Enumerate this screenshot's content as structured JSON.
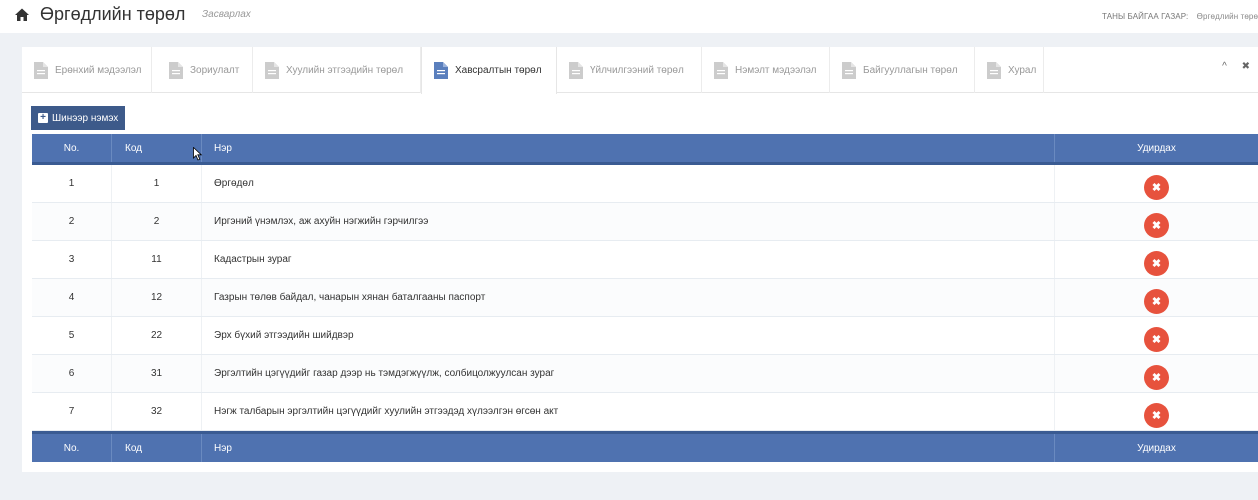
{
  "header": {
    "title": "Өргөдлийн төрөл",
    "subtitle": "Засварлах",
    "home_icon": "home-icon",
    "breadcrumb": [
      "ТАНЫ БАЙГАА ГАЗАР:",
      "Өргөдлийн төрө"
    ]
  },
  "tabs": [
    {
      "label": "Ерөнхий мэдээлэл",
      "active": false
    },
    {
      "label": "Зориулалт",
      "active": false
    },
    {
      "label": "Хуулийн этгээдийн төрөл",
      "active": false
    },
    {
      "label": "Хавсралтын төрөл",
      "active": true
    },
    {
      "label": "Үйлчилгээний төрөл",
      "active": false
    },
    {
      "label": "Нэмэлт мэдээлэл",
      "active": false
    },
    {
      "label": "Байгууллагын төрөл",
      "active": false
    },
    {
      "label": "Хурал",
      "active": false
    }
  ],
  "panel_tools": {
    "collapse": "^",
    "close": "✖"
  },
  "add_button": {
    "label": "Шинээр нэмэх"
  },
  "table": {
    "columns": {
      "no": "No.",
      "code": "Код",
      "name": "Нэр",
      "actions": "Удирдах"
    },
    "rows": [
      {
        "no": "1",
        "code": "1",
        "name": "Өргөдөл"
      },
      {
        "no": "2",
        "code": "2",
        "name": "Иргэний үнэмлэх, аж ахуйн нэгжийн гэрчилгээ"
      },
      {
        "no": "3",
        "code": "11",
        "name": "Кадастрын зураг"
      },
      {
        "no": "4",
        "code": "12",
        "name": "Газрын төлөв байдал, чанарын хянан баталгааны паспорт"
      },
      {
        "no": "5",
        "code": "22",
        "name": "Эрх бүхий этгээдийн шийдвэр"
      },
      {
        "no": "6",
        "code": "31",
        "name": "Эргэлтийн цэгүүдийг газар дээр нь тэмдэгжүүлж, солбицолжуулсан зураг"
      },
      {
        "no": "7",
        "code": "32",
        "name": "Нэгж талбарын эргэлтийн цэгүүдийг хуулийн этгээдэд хүлээлгэн өгсөн акт"
      }
    ],
    "delete_icon": "close-icon"
  },
  "colors": {
    "header_blue": "#4f72b0",
    "button_blue": "#3d5a8a",
    "delete_red": "#e7523d"
  }
}
